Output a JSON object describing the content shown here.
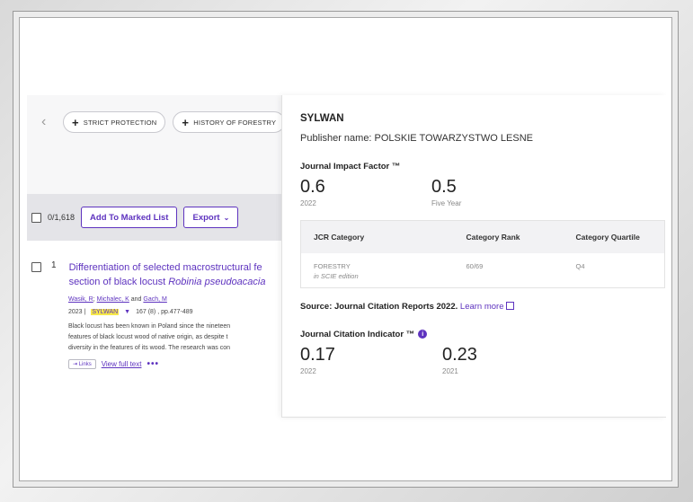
{
  "chips": {
    "prev_icon": "chevron-left-icon",
    "items": [
      "STRICT PROTECTION",
      "HISTORY OF FORESTRY"
    ]
  },
  "toolbar": {
    "count": "0/1,618",
    "add_to_marked_list": "Add To Marked List",
    "export": "Export",
    "export_icon": "chevron-down-icon"
  },
  "record": {
    "number": "1",
    "title_line1": "Differentiation of selected macrostructural fe",
    "title_line2_prefix": "section of black locust ",
    "title_line2_italic": "Robinia pseudoacacia",
    "author1": "Wasik, R",
    "author2": "Michalec, K",
    "authors_and": " and ",
    "author3": "Gach, M",
    "year": "2023 |",
    "journal": "SYLWAN",
    "citation": "167 (8) , pp.477-489",
    "abstract_line1": "Black locust has been known in Poland since the nineteen",
    "abstract_line2": "features of black locust wood of native origin, as despite t",
    "abstract_line3": "diversity in the features of its wood. The research was con",
    "links_label": "⇥ Links",
    "view_full_text": "View full text",
    "more": "•••"
  },
  "panel": {
    "journal_name": "SYLWAN",
    "publisher": "Publisher name: POLSKIE TOWARZYSTWO LESNE",
    "jif_label": "Journal Impact Factor ™",
    "jif": [
      {
        "value": "0.6",
        "label": "2022"
      },
      {
        "value": "0.5",
        "label": "Five Year"
      }
    ],
    "table_headers": [
      "JCR Category",
      "Category Rank",
      "Category Quartile"
    ],
    "table_row": {
      "category": "FORESTRY",
      "edition": "in SCIE edition",
      "rank": "60/69",
      "quartile": "Q4"
    },
    "source_text": "Source: Journal Citation Reports  2022.",
    "learn_more": "Learn more",
    "jci_label": "Journal Citation Indicator ™",
    "jci": [
      {
        "value": "0.17",
        "label": "2022"
      },
      {
        "value": "0.23",
        "label": "2021"
      }
    ]
  },
  "colors": {
    "accent": "#5e33bf",
    "highlight": "#f6e84a"
  }
}
